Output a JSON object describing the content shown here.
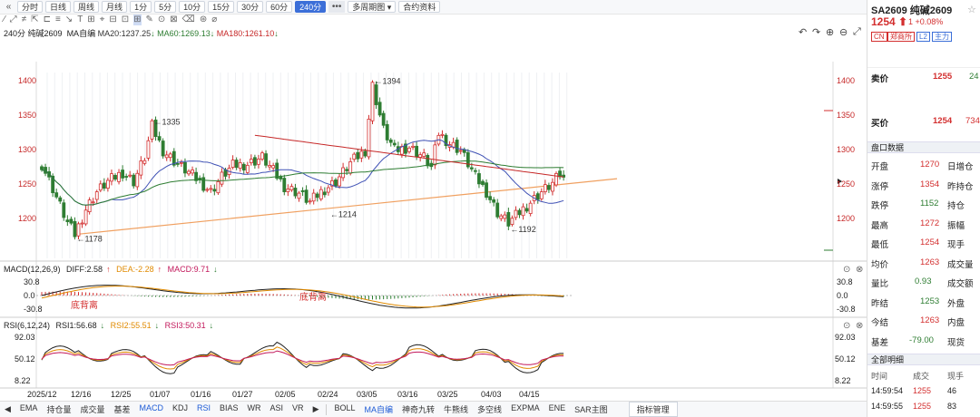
{
  "toolbar": {
    "nav_icon": "double-chevron-left-icon",
    "periods": [
      "分时",
      "日线",
      "周线",
      "月线",
      "1分",
      "5分",
      "10分",
      "15分",
      "30分",
      "60分",
      "240分"
    ],
    "active_period": "240分",
    "more": "•••",
    "multi_period": "多周期图",
    "contract_info": "合约资料"
  },
  "chart_header": {
    "period_symbol": "240分 纯碱2609",
    "ma_mode": "MA自编",
    "ma20": "MA20:1237.25",
    "ma20_arrow": "↓",
    "ma60": "MA60:1269.13",
    "ma60_arrow": "↓",
    "ma180": "MA180:1261.10",
    "ma180_arrow": "↓"
  },
  "price_axis": {
    "labels": [
      "1400",
      "1350",
      "1300",
      "1250",
      "1200"
    ]
  },
  "annotations": {
    "high": "1394",
    "peak": "1335",
    "low1": "1178",
    "low2": "1214",
    "low3": "1192"
  },
  "macd": {
    "label": "MACD(12,26,9)",
    "diff": "DIFF:2.58",
    "diff_arrow": "↑",
    "dea": "DEA:-2.28",
    "dea_arrow": "↑",
    "macd": "MACD:9.71",
    "macd_arrow": "↓",
    "axis": [
      "30.8",
      "0.0",
      "-30.8"
    ],
    "div_text": "底背离"
  },
  "rsi": {
    "label": "RSI(6,12,24)",
    "rsi1": "RSI1:56.68",
    "rsi1_arrow": "↓",
    "rsi2": "RSI2:55.51",
    "rsi2_arrow": "↓",
    "rsi3": "RSI3:50.31",
    "rsi3_arrow": "↓",
    "axis": [
      "92.03",
      "50.12",
      "8.22"
    ]
  },
  "dates": [
    "2025/12",
    "12/16",
    "12/25",
    "01/07",
    "01/16",
    "01/27",
    "02/05",
    "02/24",
    "03/05",
    "03/16",
    "03/25",
    "04/03",
    "04/15"
  ],
  "bottom_tabs_left": [
    "EMA",
    "持仓量",
    "成交量",
    "基差",
    "MACD",
    "KDJ",
    "RSI",
    "BIAS",
    "WR",
    "ASI",
    "VR"
  ],
  "active_left": [
    "MACD",
    "RSI"
  ],
  "bottom_tabs_right": [
    "BOLL",
    "MA自编",
    "神奇九转",
    "牛熊线",
    "多空线",
    "EXPMA",
    "ENE",
    "SAR主图"
  ],
  "active_right": "MA自编",
  "indicator_mgr": "指标管理",
  "side": {
    "symbol": "SA2609 纯碱2609",
    "price": "1254",
    "change": "1 +0.08%",
    "tags": [
      "CN",
      "郑商所",
      "L2",
      "主力"
    ],
    "ask_label": "卖价",
    "ask": "1255",
    "ask_vol": "24",
    "bid_label": "买价",
    "bid": "1254",
    "bid_vol": "734",
    "section": "盘口数据",
    "rows": [
      [
        "开盘",
        "1270",
        "日增仓"
      ],
      [
        "涨停",
        "1354",
        "昨持仓"
      ],
      [
        "跌停",
        "1152",
        "持仓"
      ],
      [
        "最高",
        "1272",
        "振幅"
      ],
      [
        "最低",
        "1254",
        "现手"
      ],
      [
        "均价",
        "1263",
        "成交量"
      ],
      [
        "量比",
        "0.93",
        "成交额"
      ],
      [
        "昨结",
        "1253",
        "外盘"
      ],
      [
        "今结",
        "1263",
        "内盘"
      ],
      [
        "基差",
        "-79.00",
        "现货"
      ]
    ],
    "ticks_title": "全部明细",
    "ticks_header": [
      "时间",
      "成交",
      "现手"
    ],
    "ticks": [
      [
        "14:59:54",
        "1255",
        "46"
      ],
      [
        "14:59:55",
        "1255",
        "83"
      ]
    ]
  },
  "colors": {
    "up": "#d32f2f",
    "down": "#2e7d32",
    "ma20": "#3f51b5",
    "ma60": "#2e7d32",
    "ma180": "#c62828",
    "trend": "#f0a060"
  }
}
